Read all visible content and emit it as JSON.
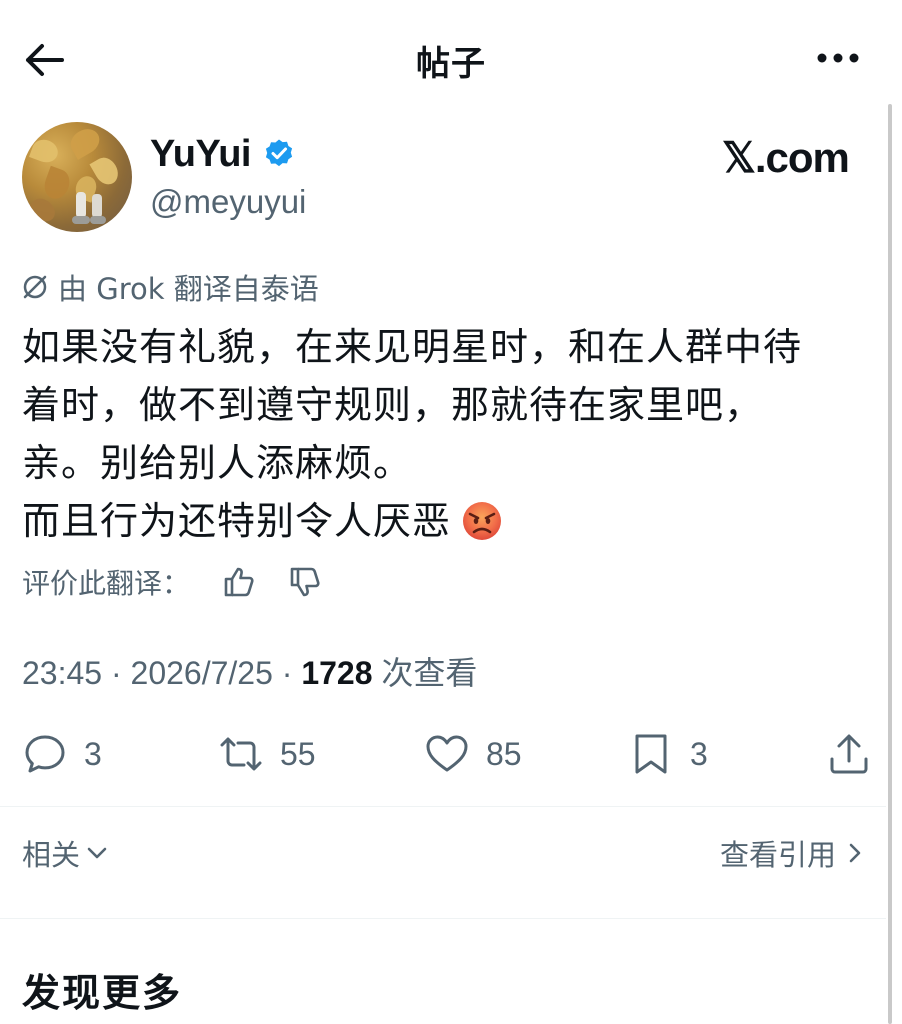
{
  "header": {
    "title": "帖子",
    "back_icon": "arrow-left-icon",
    "more_icon": "more-horizontal-icon"
  },
  "author": {
    "name": "YuYui",
    "handle": "@meyuyui",
    "verified": true,
    "verified_color": "#1d9bf0"
  },
  "watermark": "𝕏.com",
  "translation": {
    "label": "由 Grok 翻译自泰语",
    "lines": [
      "如果没有礼貌，在来见明星时，和在人群中待",
      "着时，做不到遵守规则，那就待在家里吧，",
      "亲。别给别人添麻烦。",
      "而且行为还特别令人厌恶"
    ],
    "emoji": "pouting-face-emoji",
    "rate_label": "评价此翻译："
  },
  "meta": {
    "time": "23:45",
    "separator": " · ",
    "date": "2026/7/25",
    "views": "1728",
    "views_label": " 次查看"
  },
  "actions": {
    "replies": "3",
    "reposts": "55",
    "likes": "85",
    "bookmarks": "3"
  },
  "related": {
    "left_label": "相关",
    "right_label": "查看引用"
  },
  "discover": {
    "title": "发现更多"
  }
}
